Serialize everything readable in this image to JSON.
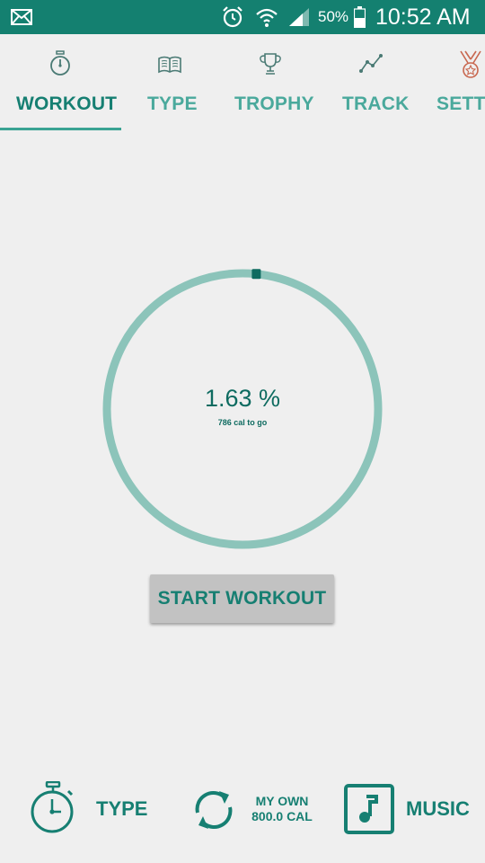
{
  "status_bar": {
    "icons": [
      "mail-icon",
      "alarm-icon",
      "wifi-icon",
      "signal-icon",
      "battery-icon"
    ],
    "battery_text": "50%",
    "time": "10:52 AM",
    "background_color": "#148070"
  },
  "tabs": [
    {
      "label": "WORKOUT",
      "icon": "stopwatch-icon",
      "active": true
    },
    {
      "label": "TYPE",
      "icon": "book-icon",
      "active": false
    },
    {
      "label": "TROPHY",
      "icon": "trophy-icon",
      "active": false
    },
    {
      "label": "TRACK",
      "icon": "line-graph-icon",
      "active": false
    },
    {
      "label": "SETTI",
      "icon": "medal-icon",
      "active": false
    }
  ],
  "progress": {
    "percent_text": "1.63 %",
    "percent_value": 1.63,
    "sub_text": "786 cal to go",
    "ring_color": "#8cc4ba",
    "marker_color": "#0e6b60"
  },
  "start_button": {
    "label": "START WORKOUT"
  },
  "bottom_bar": {
    "type_label": "TYPE",
    "myown_line1": "MY OWN",
    "myown_line2": "800.0 CAL",
    "music_label": "MUSIC"
  },
  "colors": {
    "accent": "#167f72",
    "accent_light": "#4aa99c",
    "background": "#efefef"
  }
}
